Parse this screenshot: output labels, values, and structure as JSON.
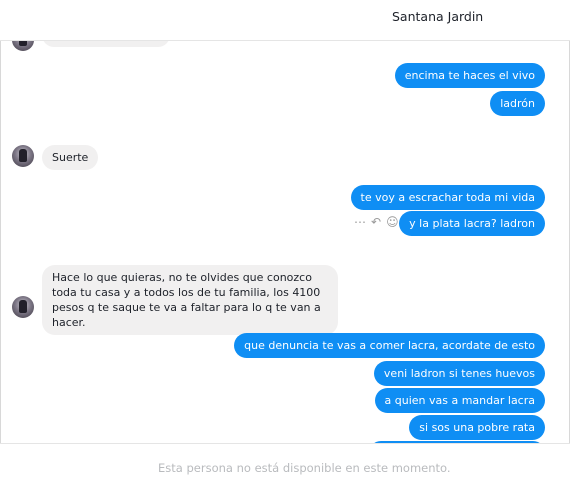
{
  "header": {
    "contact_name": "Santana Jardin"
  },
  "messages": [
    {
      "side": "out",
      "text": "encima te haces el vivo"
    },
    {
      "side": "out",
      "text": "ladrón"
    },
    {
      "side": "in",
      "text": "Suerte"
    },
    {
      "side": "out",
      "text": "te voy a escrachar toda mi vida"
    },
    {
      "side": "out",
      "text": "y la plata lacra? ladron"
    },
    {
      "side": "in",
      "text": "Hace lo que quieras, no te olvides que conozco toda tu casa y a todos los de tu familia, los 4100 pesos q te saque te va a faltar para lo q te van a hacer."
    },
    {
      "side": "out",
      "text": "que denuncia te vas a comer lacra, acordate de esto"
    },
    {
      "side": "out",
      "text": "veni ladron si tenes huevos"
    },
    {
      "side": "out",
      "text": "a quien vas a mandar lacra"
    },
    {
      "side": "out",
      "text": "si sos una pobre rata"
    }
  ],
  "message_actions": {
    "more": "more-icon",
    "reply": "reply-icon",
    "react": "smiley-icon"
  },
  "composer": {
    "unavailable_notice": "Esta persona no está disponible en este momento."
  }
}
